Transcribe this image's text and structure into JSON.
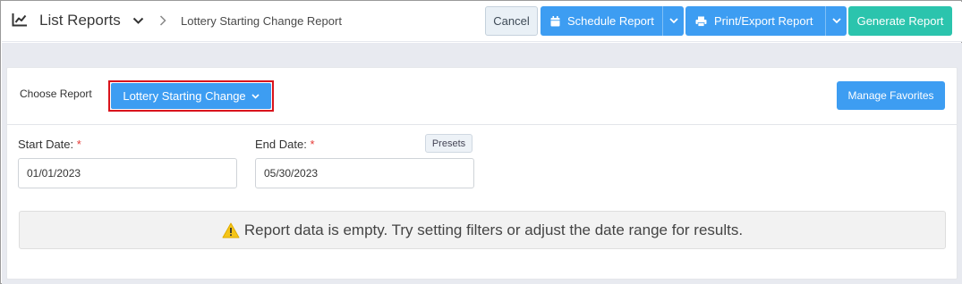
{
  "header": {
    "title": "List Reports",
    "breadcrumb": "Lottery Starting Change Report",
    "cancel_label": "Cancel",
    "schedule_label": "Schedule Report",
    "print_label": "Print/Export Report",
    "generate_label": "Generate Report"
  },
  "panel": {
    "choose_label": "Choose Report",
    "selected_report": "Lottery Starting Change",
    "manage_favorites_label": "Manage Favorites"
  },
  "filters": {
    "start_label": "Start Date:",
    "end_label": "End Date:",
    "required_mark": "*",
    "presets_label": "Presets",
    "start_value": "01/01/2023",
    "end_value": "05/30/2023"
  },
  "empty_message": "Report data is empty. Try setting filters or adjust the date range for results.",
  "colors": {
    "primary": "#3d9df2",
    "success": "#2bc4ad",
    "highlight": "#d9141c",
    "warning": "#f5c518"
  },
  "icons": [
    "line-chart-icon",
    "chevron-down-icon",
    "chevron-right-icon",
    "calendar-icon",
    "printer-icon",
    "warning-icon"
  ]
}
